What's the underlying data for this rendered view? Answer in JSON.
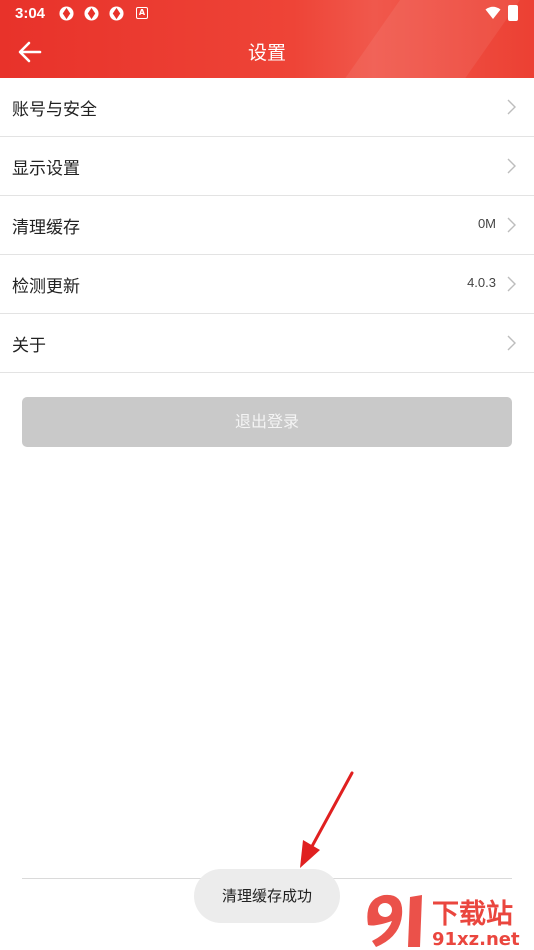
{
  "status_bar": {
    "time": "3:04",
    "notification_icons": [
      "app-icon",
      "app-icon",
      "app-icon"
    ],
    "a_icon_letter": "A"
  },
  "app_bar": {
    "title": "设置",
    "back_icon": "arrow-left-icon"
  },
  "settings": [
    {
      "label": "账号与安全",
      "value": ""
    },
    {
      "label": "显示设置",
      "value": ""
    },
    {
      "label": "清理缓存",
      "value": "0M"
    },
    {
      "label": "检测更新",
      "value": "4.0.3"
    },
    {
      "label": "关于",
      "value": ""
    }
  ],
  "logout_label": "退出登录",
  "toast": "清理缓存成功",
  "watermark": {
    "top": "下载站",
    "bottom": "91xz.net"
  },
  "colors": {
    "header_red": "#e8322a",
    "annotation_arrow": "#e02020",
    "button_disabled": "#c9c9c9"
  }
}
